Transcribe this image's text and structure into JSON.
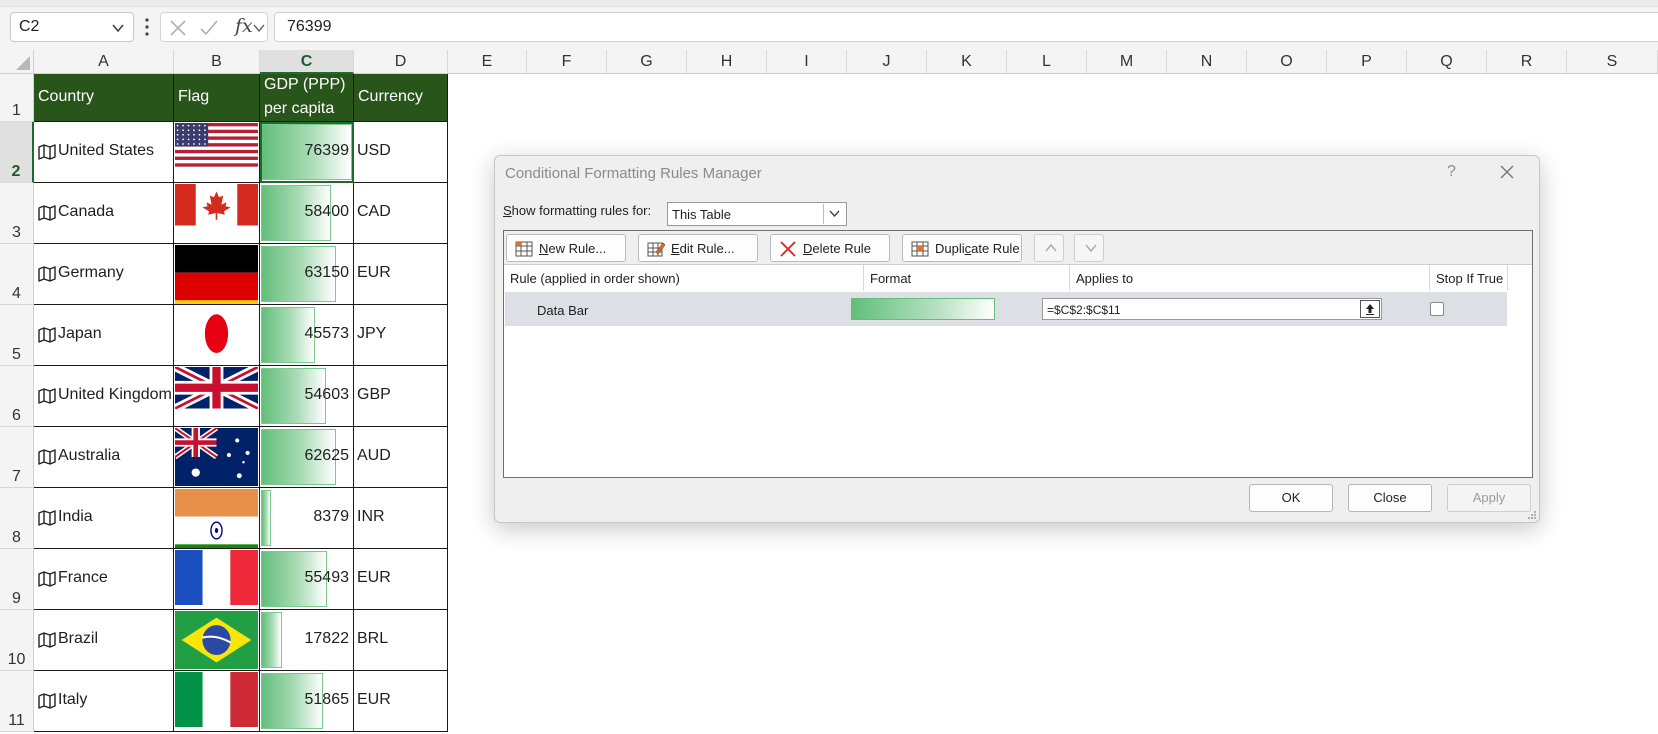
{
  "formula_bar": {
    "name_box": "C2",
    "fx_label": "fx",
    "formula_value": "76399"
  },
  "columns": [
    "A",
    "B",
    "C",
    "D",
    "E",
    "F",
    "G",
    "H",
    "I",
    "J",
    "K",
    "L",
    "M",
    "N",
    "O",
    "P",
    "Q",
    "R",
    "S"
  ],
  "rows": [
    "1",
    "2",
    "3",
    "4",
    "5",
    "6",
    "7",
    "8",
    "9",
    "10",
    "11"
  ],
  "table": {
    "headers": {
      "country": "Country",
      "flag": "Flag",
      "gdp_line1": "GDP (PPP)",
      "gdp_line2": "per capita",
      "currency": "Currency"
    },
    "max_gdp": 76399,
    "data": [
      {
        "country": "United States",
        "flag": "flag-us",
        "gdp": "76399",
        "currency": "USD"
      },
      {
        "country": "Canada",
        "flag": "flag-ca",
        "gdp": "58400",
        "currency": "CAD"
      },
      {
        "country": "Germany",
        "flag": "flag-de",
        "gdp": "63150",
        "currency": "EUR"
      },
      {
        "country": "Japan",
        "flag": "flag-jp",
        "gdp": "45573",
        "currency": "JPY"
      },
      {
        "country": "United Kingdom",
        "flag": "flag-gb",
        "gdp": "54603",
        "currency": "GBP"
      },
      {
        "country": "Australia",
        "flag": "flag-au",
        "gdp": "62625",
        "currency": "AUD"
      },
      {
        "country": "India",
        "flag": "flag-in",
        "gdp": "8379",
        "currency": "INR"
      },
      {
        "country": "France",
        "flag": "flag-fr",
        "gdp": "55493",
        "currency": "EUR"
      },
      {
        "country": "Brazil",
        "flag": "flag-br",
        "gdp": "17822",
        "currency": "BRL"
      },
      {
        "country": "Italy",
        "flag": "flag-it",
        "gdp": "51865",
        "currency": "EUR"
      }
    ]
  },
  "dialog": {
    "title": "Conditional Formatting Rules Manager",
    "help": "?",
    "show_label_prefix": "S",
    "show_label_rest": "how formatting rules for:",
    "show_value": "This Table",
    "buttons": {
      "new_rule_u": "N",
      "new_rule_rest": "ew Rule...",
      "edit_rule_u": "E",
      "edit_rule_rest": "dit Rule...",
      "delete_rule_u": "D",
      "delete_rule_rest": "elete Rule",
      "dup_rule_a": "Dupli",
      "dup_rule_u": "c",
      "dup_rule_b": "ate Rule"
    },
    "columns": {
      "rule": "Rule (applied in order shown)",
      "format": "Format",
      "applies": "Applies to",
      "stop": "Stop If True"
    },
    "rule": {
      "name": "Data Bar",
      "applies_to": "=$C$2:$C$11",
      "stop_if_true": false
    },
    "ok": "OK",
    "close": "Close",
    "apply": "Apply"
  }
}
